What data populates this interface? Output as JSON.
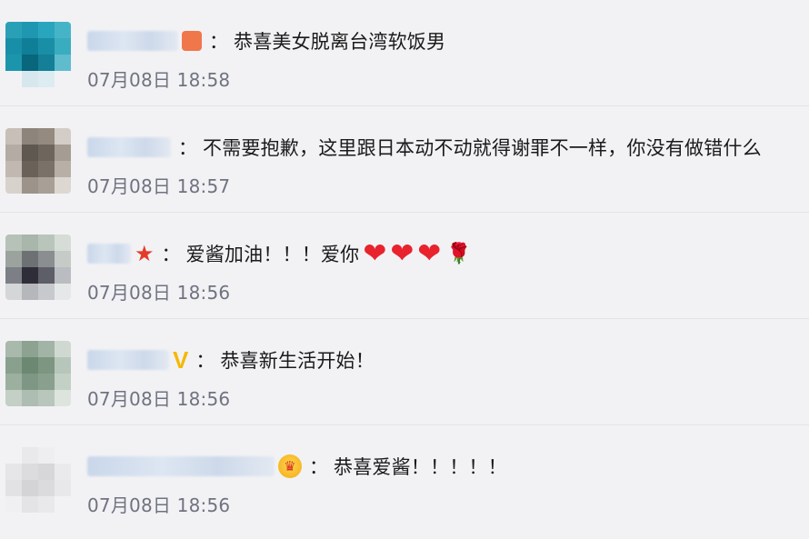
{
  "comments": [
    {
      "text": "恭喜美女脱离台湾软饭男",
      "time": "07月08日 18:58",
      "colon": "："
    },
    {
      "text": "不需要抱歉，这里跟日本动不动就得谢罪不一样，你没有做错什么",
      "time": "07月08日 18:57",
      "colon": "："
    },
    {
      "text": "爱酱加油！！！爱你",
      "time": "07月08日 18:56",
      "colon": "：",
      "emoji": [
        "❤",
        "❤",
        "❤",
        "🌹"
      ]
    },
    {
      "text": "恭喜新生活开始！",
      "time": "07月08日 18:56",
      "colon": "："
    },
    {
      "text": "恭喜爱酱！！！！！",
      "time": "07月08日 18:56",
      "colon": "："
    }
  ],
  "badges": {
    "star": "★",
    "v": "V",
    "crown": "♛"
  }
}
